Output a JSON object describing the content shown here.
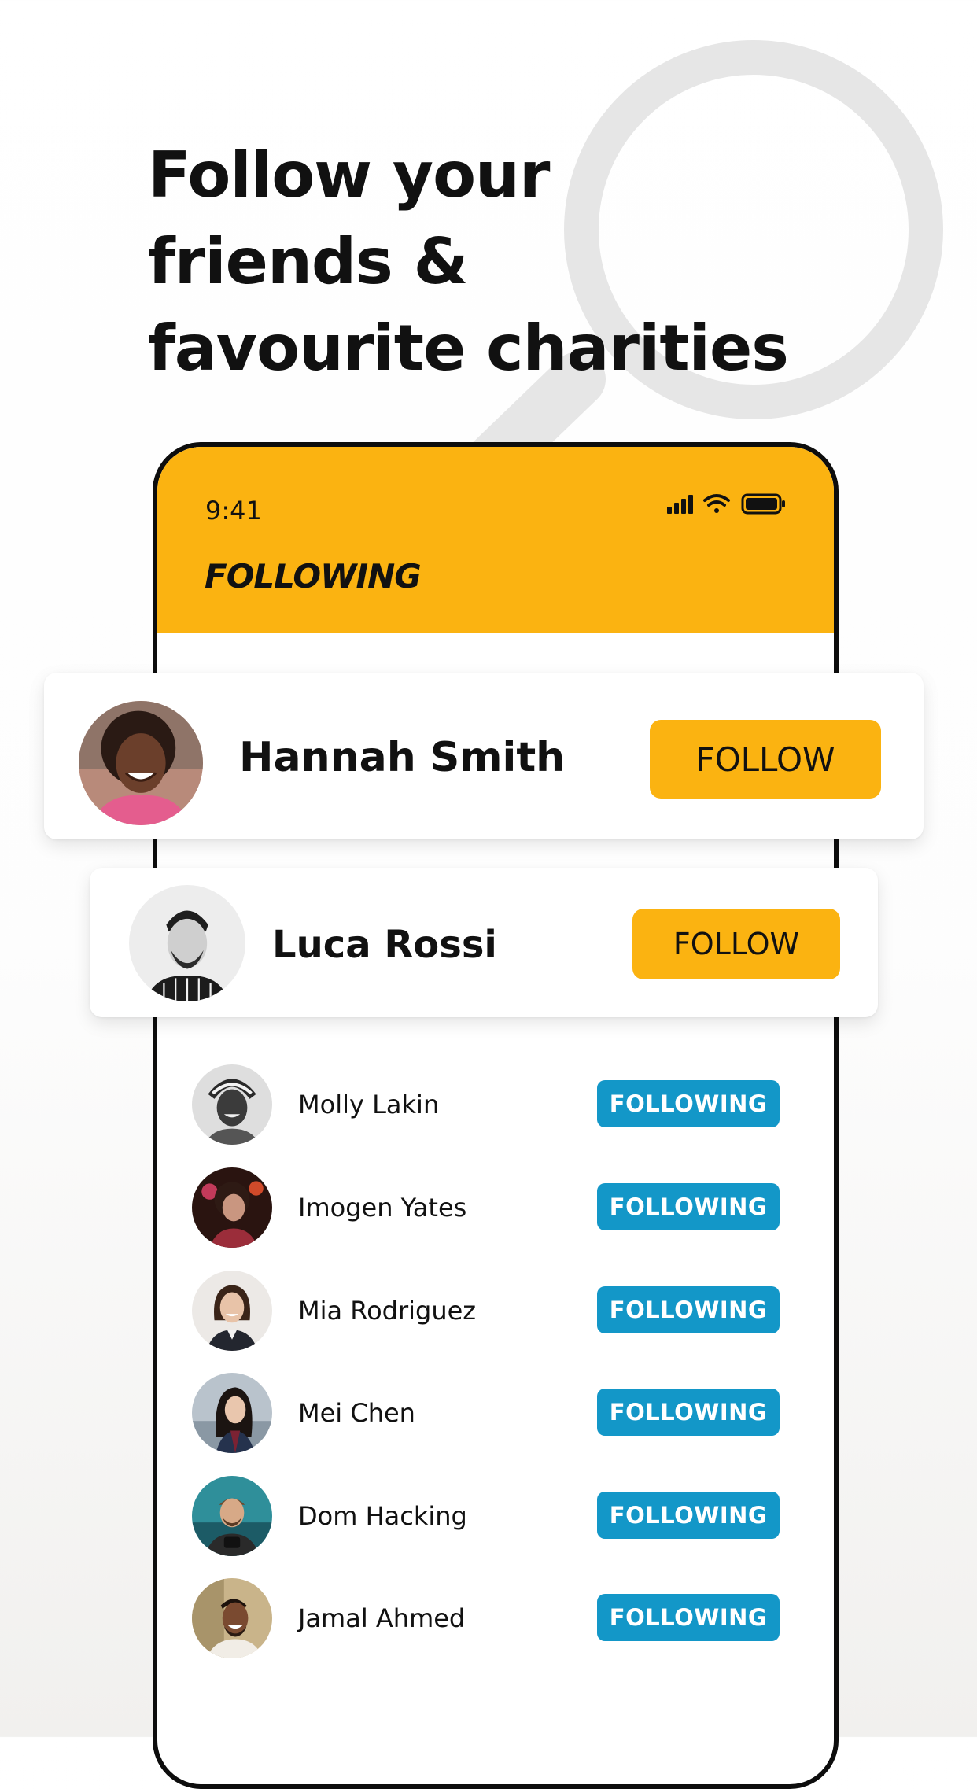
{
  "headline": {
    "lines": [
      "Follow your",
      "friends &",
      "favourite charities"
    ]
  },
  "phone": {
    "status_bar": {
      "time": "9:41",
      "icons": [
        "signal-icon",
        "wifi-icon",
        "battery-icon"
      ]
    },
    "screen_title": "FOLLOWING",
    "header_color": "#fbb311"
  },
  "featured_cards": [
    {
      "name": "Hannah Smith",
      "button_label": "FOLLOW"
    },
    {
      "name": "Luca Rossi",
      "button_label": "FOLLOW"
    }
  ],
  "following_list": [
    {
      "name": "Molly Lakin",
      "button_label": "FOLLOWING"
    },
    {
      "name": "Imogen Yates",
      "button_label": "FOLLOWING"
    },
    {
      "name": "Mia Rodriguez",
      "button_label": "FOLLOWING"
    },
    {
      "name": "Mei Chen",
      "button_label": "FOLLOWING"
    },
    {
      "name": "Dom Hacking",
      "button_label": "FOLLOWING"
    },
    {
      "name": "Jamal Ahmed",
      "button_label": "FOLLOWING"
    }
  ],
  "colors": {
    "accent_yellow": "#fbb311",
    "following_blue": "#1397c8",
    "text": "#111111"
  }
}
